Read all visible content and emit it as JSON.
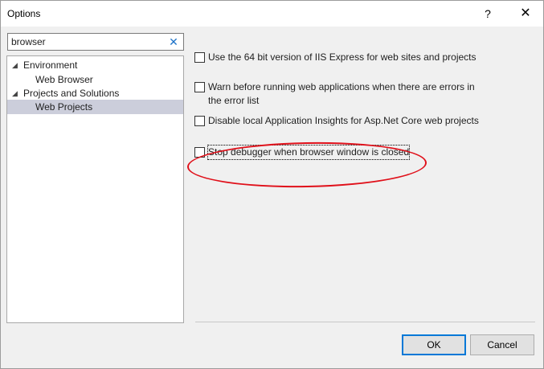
{
  "window": {
    "title": "Options",
    "help": "?",
    "close": "✕"
  },
  "search": {
    "value": "browser",
    "clear": "✕"
  },
  "tree": {
    "items": [
      {
        "label": "Environment",
        "expander": "◢",
        "selected": false
      },
      {
        "label": "Web Browser",
        "expander": "",
        "selected": false
      },
      {
        "label": "Projects and Solutions",
        "expander": "◢",
        "selected": false
      },
      {
        "label": "Web Projects",
        "expander": "",
        "selected": true
      }
    ]
  },
  "options": [
    {
      "label": "Use the 64 bit version of IIS Express for web sites and projects",
      "checked": false
    },
    {
      "label": "Warn before running web applications when there are errors in the error list",
      "checked": false
    },
    {
      "label": "Disable local Application Insights for Asp.Net Core web projects",
      "checked": false
    },
    {
      "label": "Stop debugger when browser window is closed",
      "checked": false
    }
  ],
  "buttons": {
    "ok": "OK",
    "cancel": "Cancel"
  },
  "colors": {
    "annotation": "#e0101a",
    "selection": "#cccedb",
    "accent": "#0078d7"
  }
}
